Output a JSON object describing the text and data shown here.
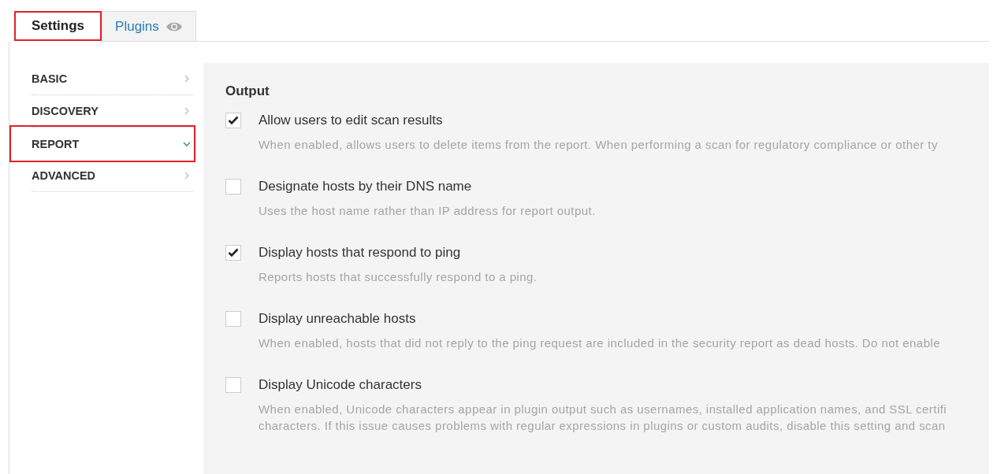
{
  "tabs": [
    {
      "label": "Settings",
      "selected": true,
      "highlighted": true,
      "kind": "plain"
    },
    {
      "label": "Plugins",
      "selected": false,
      "highlighted": false,
      "kind": "icon"
    }
  ],
  "sidebar": {
    "items": [
      {
        "label": "BASIC",
        "expanded": false,
        "highlighted": false
      },
      {
        "label": "DISCOVERY",
        "expanded": false,
        "highlighted": false
      },
      {
        "label": "REPORT",
        "expanded": true,
        "highlighted": true
      },
      {
        "label": "ADVANCED",
        "expanded": false,
        "highlighted": false
      }
    ]
  },
  "section": {
    "title": "Output",
    "options": [
      {
        "label": "Allow users to edit scan results",
        "checked": true,
        "description": [
          "When enabled, allows users to delete items from the report. When performing a scan for regulatory compliance or other ty"
        ]
      },
      {
        "label": "Designate hosts by their DNS name",
        "checked": false,
        "description": [
          "Uses the host name rather than IP address for report output."
        ]
      },
      {
        "label": "Display hosts that respond to ping",
        "checked": true,
        "description": [
          "Reports hosts that successfully respond to a ping."
        ]
      },
      {
        "label": "Display unreachable hosts",
        "checked": false,
        "description": [
          "When enabled, hosts that did not reply to the ping request are included in the security report as dead hosts. Do not enable"
        ]
      },
      {
        "label": "Display Unicode characters",
        "checked": false,
        "description": [
          "When enabled, Unicode characters appear in plugin output such as usernames, installed application names, and SSL certifi",
          "characters. If this issue causes problems with regular expressions in plugins or custom audits, disable this setting and scan"
        ]
      }
    ]
  }
}
